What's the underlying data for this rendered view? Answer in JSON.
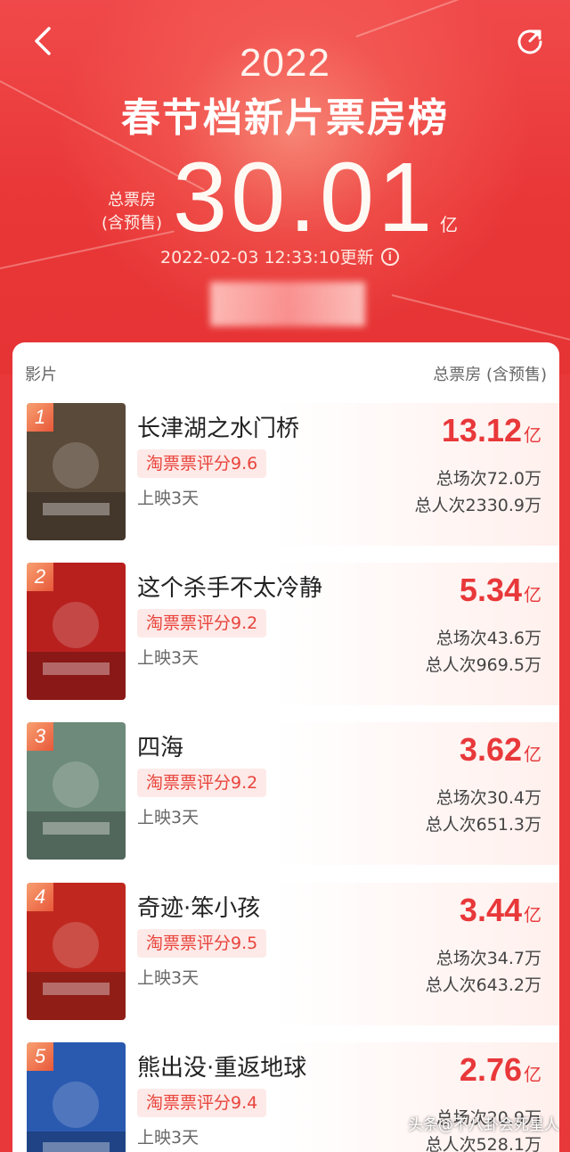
{
  "header": {
    "year": "2022",
    "title": "春节档新片票房榜",
    "total_label_line1": "总票房",
    "total_label_line2": "(含预售)",
    "total_value": "30.01",
    "total_unit": "亿",
    "updated": "2022-02-03 12:33:10更新"
  },
  "table": {
    "col_film": "影片",
    "col_gross": "总票房 (含预售)"
  },
  "movies": [
    {
      "rank": "1",
      "name": "长津湖之水门桥",
      "score": "淘票票评分9.6",
      "days": "上映3天",
      "gross": "13.12",
      "unit": "亿",
      "shows": "总场次72.0万",
      "audience": "总人次2330.9万",
      "poster_color": "#5a4a3a"
    },
    {
      "rank": "2",
      "name": "这个杀手不太冷静",
      "score": "淘票票评分9.2",
      "days": "上映3天",
      "gross": "5.34",
      "unit": "亿",
      "shows": "总场次43.6万",
      "audience": "总人次969.5万",
      "poster_color": "#b8201e"
    },
    {
      "rank": "3",
      "name": "四海",
      "score": "淘票票评分9.2",
      "days": "上映3天",
      "gross": "3.62",
      "unit": "亿",
      "shows": "总场次30.4万",
      "audience": "总人次651.3万",
      "poster_color": "#6e8a7a"
    },
    {
      "rank": "4",
      "name": "奇迹·笨小孩",
      "score": "淘票票评分9.5",
      "days": "上映3天",
      "gross": "3.44",
      "unit": "亿",
      "shows": "总场次34.7万",
      "audience": "总人次643.2万",
      "poster_color": "#c0281f"
    },
    {
      "rank": "5",
      "name": "熊出没·重返地球",
      "score": "淘票票评分9.4",
      "days": "上映3天",
      "gross": "2.76",
      "unit": "亿",
      "shows": "总场次20.9万",
      "audience": "总人次528.1万",
      "poster_color": "#2a5ab0"
    }
  ],
  "watermark": "头条@不八卦会死星人",
  "colors": {
    "accent": "#e8383a",
    "badge": "#f07a50"
  }
}
